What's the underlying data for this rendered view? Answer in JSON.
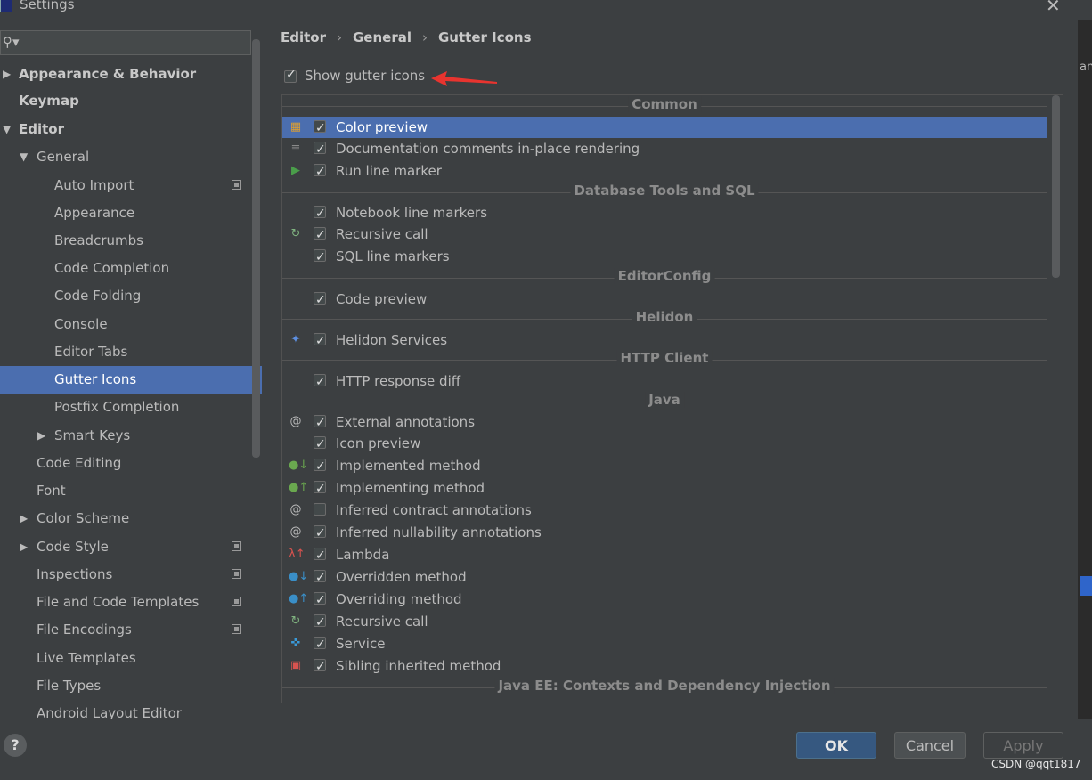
{
  "window": {
    "title": "Settings"
  },
  "search": {
    "placeholder": ""
  },
  "sidebar": {
    "items": [
      {
        "label": "Appearance & Behavior",
        "arrow": "▶",
        "bold": true,
        "indent": 0
      },
      {
        "label": "Keymap",
        "arrow": "",
        "bold": true,
        "indent": 0
      },
      {
        "label": "Editor",
        "arrow": "▼",
        "bold": true,
        "indent": 0
      },
      {
        "label": "General",
        "arrow": "▼",
        "bold": false,
        "indent": 1
      },
      {
        "label": "Auto Import",
        "arrow": "",
        "bold": false,
        "indent": 2,
        "copy": true
      },
      {
        "label": "Appearance",
        "arrow": "",
        "bold": false,
        "indent": 2
      },
      {
        "label": "Breadcrumbs",
        "arrow": "",
        "bold": false,
        "indent": 2
      },
      {
        "label": "Code Completion",
        "arrow": "",
        "bold": false,
        "indent": 2
      },
      {
        "label": "Code Folding",
        "arrow": "",
        "bold": false,
        "indent": 2
      },
      {
        "label": "Console",
        "arrow": "",
        "bold": false,
        "indent": 2
      },
      {
        "label": "Editor Tabs",
        "arrow": "",
        "bold": false,
        "indent": 2
      },
      {
        "label": "Gutter Icons",
        "arrow": "",
        "bold": false,
        "indent": 2,
        "selected": true
      },
      {
        "label": "Postfix Completion",
        "arrow": "",
        "bold": false,
        "indent": 2
      },
      {
        "label": "Smart Keys",
        "arrow": "▶",
        "bold": false,
        "indent": 2
      },
      {
        "label": "Code Editing",
        "arrow": "",
        "bold": false,
        "indent": 1
      },
      {
        "label": "Font",
        "arrow": "",
        "bold": false,
        "indent": 1
      },
      {
        "label": "Color Scheme",
        "arrow": "▶",
        "bold": false,
        "indent": 1
      },
      {
        "label": "Code Style",
        "arrow": "▶",
        "bold": false,
        "indent": 1,
        "copy": true
      },
      {
        "label": "Inspections",
        "arrow": "",
        "bold": false,
        "indent": 1,
        "copy": true
      },
      {
        "label": "File and Code Templates",
        "arrow": "",
        "bold": false,
        "indent": 1,
        "copy": true
      },
      {
        "label": "File Encodings",
        "arrow": "",
        "bold": false,
        "indent": 1,
        "copy": true
      },
      {
        "label": "Live Templates",
        "arrow": "",
        "bold": false,
        "indent": 1
      },
      {
        "label": "File Types",
        "arrow": "",
        "bold": false,
        "indent": 1
      },
      {
        "label": "Android Layout Editor",
        "arrow": "",
        "bold": false,
        "indent": 1
      }
    ]
  },
  "breadcrumb": {
    "part1": "Editor",
    "part2": "General",
    "part3": "Gutter Icons",
    "sep": "›"
  },
  "show_gutter": {
    "label": "Show gutter icons",
    "checked": true
  },
  "sections": [
    {
      "title": "Common",
      "rows": [
        {
          "label": "Color preview",
          "checked": true,
          "icon": "color-grid-icon",
          "selected": true
        },
        {
          "label": "Documentation comments in-place rendering",
          "checked": true,
          "icon": "doc-lines-icon"
        },
        {
          "label": "Run line marker",
          "checked": true,
          "icon": "run-triangle-icon"
        }
      ]
    },
    {
      "title": "Database Tools and SQL",
      "rows": [
        {
          "label": "Notebook line markers",
          "checked": true,
          "icon": ""
        },
        {
          "label": "Recursive call",
          "checked": true,
          "icon": "recursive-icon"
        },
        {
          "label": "SQL line markers",
          "checked": true,
          "icon": ""
        }
      ]
    },
    {
      "title": "EditorConfig",
      "rows": [
        {
          "label": "Code preview",
          "checked": true,
          "icon": ""
        }
      ]
    },
    {
      "title": "Helidon",
      "rows": [
        {
          "label": "Helidon Services",
          "checked": true,
          "icon": "helidon-icon"
        }
      ]
    },
    {
      "title": "HTTP Client",
      "rows": [
        {
          "label": "HTTP response diff",
          "checked": true,
          "icon": ""
        }
      ]
    },
    {
      "title": "Java",
      "rows": [
        {
          "label": "External annotations",
          "checked": true,
          "icon": "at-icon"
        },
        {
          "label": "Icon preview",
          "checked": true,
          "icon": ""
        },
        {
          "label": "Implemented method",
          "checked": true,
          "icon": "implemented-icon"
        },
        {
          "label": "Implementing method",
          "checked": true,
          "icon": "implementing-icon"
        },
        {
          "label": "Inferred contract annotations",
          "checked": false,
          "icon": "at-icon"
        },
        {
          "label": "Inferred nullability annotations",
          "checked": true,
          "icon": "at-icon"
        },
        {
          "label": "Lambda",
          "checked": true,
          "icon": "lambda-icon"
        },
        {
          "label": "Overridden method",
          "checked": true,
          "icon": "overridden-icon"
        },
        {
          "label": "Overriding method",
          "checked": true,
          "icon": "overriding-icon"
        },
        {
          "label": "Recursive call",
          "checked": true,
          "icon": "recursive-icon"
        },
        {
          "label": "Service",
          "checked": true,
          "icon": "service-icon"
        },
        {
          "label": "Sibling inherited method",
          "checked": true,
          "icon": "sibling-icon"
        }
      ]
    },
    {
      "title": "Java EE: Contexts and Dependency Injection",
      "rows": []
    }
  ],
  "footer": {
    "ok": "OK",
    "cancel": "Cancel",
    "apply": "Apply",
    "help": "?"
  },
  "watermark": "CSDN @qqt1817",
  "strip_text": "ant",
  "colors": {
    "selection": "#4b6eaf",
    "ok_button": "#365880",
    "annotation_arrow": "#e8342f"
  }
}
